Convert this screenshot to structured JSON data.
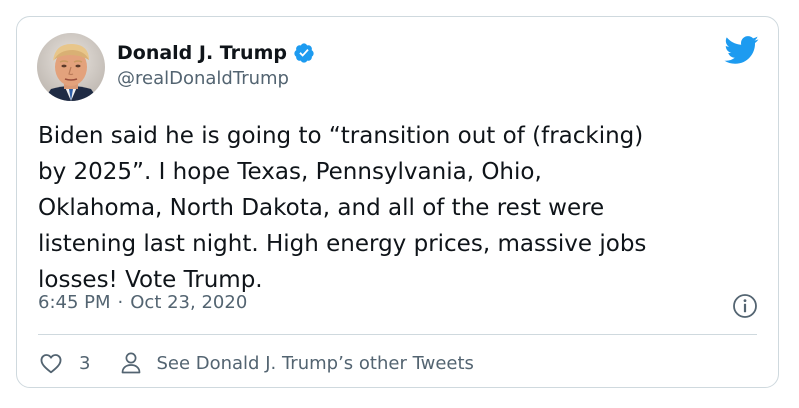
{
  "author": {
    "display_name": "Donald J. Trump",
    "handle": "@realDonaldTrump",
    "verified": true,
    "avatar_icon": "avatar-photo"
  },
  "tweet": {
    "text": "Biden said he is going to “transition out of (fracking)\nby 2025”. I hope Texas, Pennsylvania, Ohio,\nOklahoma, North Dakota, and all of the rest were\nlistening last night. High energy prices, massive jobs\nlosses! Vote Trump.",
    "time": "6:45 PM",
    "separator": "·",
    "date": "Oct 23, 2020"
  },
  "actions": {
    "like_count": "3",
    "profile_link_label": "See Donald J. Trump’s other Tweets"
  },
  "icons": {
    "brand": "twitter-bird-icon",
    "verified": "verified-badge-icon",
    "info": "info-icon",
    "like": "heart-icon",
    "profile": "person-icon"
  },
  "colors": {
    "brand_blue": "#1d9bf0",
    "text_primary": "#0f1419",
    "text_secondary": "#536471",
    "border": "#cfd9de"
  }
}
